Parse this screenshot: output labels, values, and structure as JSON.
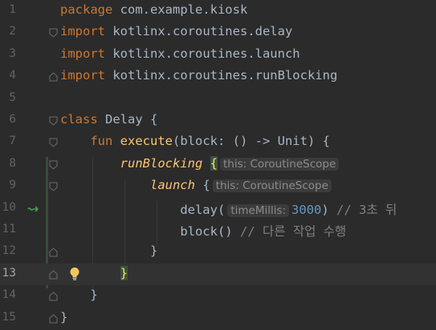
{
  "editor": {
    "current_line": 13,
    "lines": [
      {
        "no": "1",
        "seg": [
          "package",
          " com.example.kiosk"
        ]
      },
      {
        "no": "2",
        "seg": [
          "import",
          " kotlinx.coroutines.delay"
        ]
      },
      {
        "no": "3",
        "seg": [
          "import",
          " kotlinx.coroutines.launch"
        ]
      },
      {
        "no": "4",
        "seg": [
          "import",
          " kotlinx.coroutines.runBlocking"
        ]
      },
      {
        "no": "5",
        "seg": []
      },
      {
        "no": "6",
        "seg": [
          "class",
          " Delay {"
        ]
      },
      {
        "no": "7",
        "seg": [
          "    ",
          "fun",
          " ",
          "execute",
          "(block: () -> Unit) {"
        ]
      },
      {
        "no": "8",
        "seg": [
          "        ",
          "runBlocking",
          " ",
          "{",
          "this: CoroutineScope"
        ]
      },
      {
        "no": "9",
        "seg": [
          "            ",
          "launch",
          " {",
          "this: CoroutineScope"
        ]
      },
      {
        "no": "10",
        "seg": [
          "                ",
          "delay(",
          "timeMillis:",
          "3000",
          ")",
          " // 3초 뒤"
        ]
      },
      {
        "no": "11",
        "seg": [
          "                ",
          "block()",
          " // 다른 작업 수행"
        ]
      },
      {
        "no": "12",
        "seg": [
          "            ",
          "}"
        ]
      },
      {
        "no": "13",
        "seg": [
          "        ",
          "}"
        ]
      },
      {
        "no": "14",
        "seg": [
          "    ",
          "}"
        ]
      },
      {
        "no": "15",
        "seg": [
          "}"
        ]
      }
    ]
  },
  "gutter": {
    "run_icon": "coroutine-suspend-call-icon",
    "intention_icon": "lightbulb-icon",
    "fold_icon": "fold-marker-icon"
  },
  "colors": {
    "background": "#2b2b2b",
    "keyword": "#cc7832",
    "function": "#ffc66d",
    "number": "#6897bb",
    "comment": "#808080",
    "text": "#a9b7c6",
    "hint": "#8c8c8c",
    "matched_brace": "#ffef28"
  }
}
